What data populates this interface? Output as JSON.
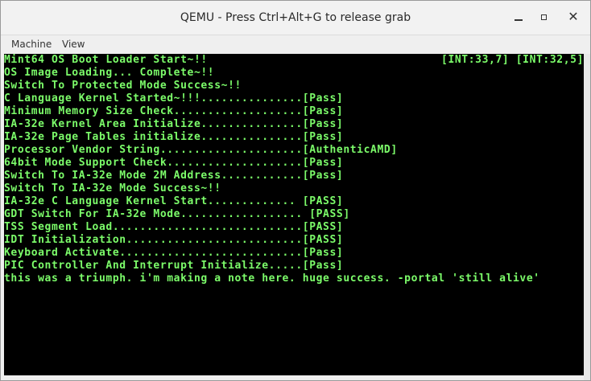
{
  "window": {
    "title": "QEMU - Press Ctrl+Alt+G to release grab",
    "minimize_icon": "minimize-icon",
    "maximize_icon": "maximize-icon",
    "close_icon": "close-icon",
    "close_glyph": "✕"
  },
  "menubar": {
    "items": [
      "Machine",
      "View"
    ]
  },
  "console": {
    "text_color": "#7cfc6a",
    "background": "#000000",
    "interrupt_status": "[INT:33,7] [INT:32,5]",
    "lines": [
      "Mint64 OS Boot Loader Start~!!",
      "OS Image Loading... Complete~!!",
      "Switch To Protected Mode Success~!!",
      "C Language Kernel Started~!!!...............[Pass]",
      "Minimum Memory Size Check...................[Pass]",
      "IA-32e Kernel Area Initialize...............[Pass]",
      "IA-32e Page Tables initialize...............[Pass]",
      "Processor Vendor String.....................[AuthenticAMD]",
      "64bit Mode Support Check....................[Pass]",
      "Switch To IA-32e Mode 2M Address............[Pass]",
      "Switch To IA-32e Mode Success~!!",
      "IA-32e C Language Kernel Start............. [PASS]",
      "GDT Switch For IA-32e Mode.................. [PASS]",
      "TSS Segment Load............................[PASS]",
      "IDT Initialization..........................[PASS]",
      "Keyboard Activate...........................[Pass]",
      "PIC Controller And Interrupt Initialize.....[Pass]",
      "this was a triumph. i'm making a note here. huge success. -portal 'still alive'"
    ]
  }
}
